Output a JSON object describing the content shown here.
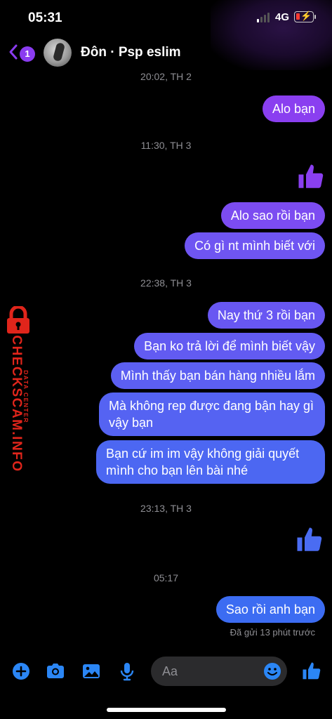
{
  "status": {
    "time": "05:31",
    "network": "4G"
  },
  "header": {
    "back_badge": "1",
    "contact_name": "Đôn · Psp eslim"
  },
  "messages": [
    {
      "type": "timestamp",
      "text": "20:02, TH 2"
    },
    {
      "type": "out",
      "text": "Alo bạn"
    },
    {
      "type": "timestamp",
      "text": "11:30, TH 3"
    },
    {
      "type": "like"
    },
    {
      "type": "out",
      "text": "Alo sao rồi bạn"
    },
    {
      "type": "out",
      "text": "Có gì nt mình biết với"
    },
    {
      "type": "timestamp",
      "text": "22:38, TH 3"
    },
    {
      "type": "out",
      "text": "Nay thứ 3 rồi bạn"
    },
    {
      "type": "out",
      "text": "Bạn ko trả lời để mình biết vậy"
    },
    {
      "type": "out",
      "text": "Mình thấy bạn bán hàng nhiều lắm"
    },
    {
      "type": "out",
      "text": "Mà không rep được đang bận hay gì vậy bạn"
    },
    {
      "type": "out",
      "text": "Bạn cứ im im vậy không giải quyết mình cho bạn lên bài nhé"
    },
    {
      "type": "timestamp",
      "text": "23:13, TH 3"
    },
    {
      "type": "like"
    },
    {
      "type": "timestamp",
      "text": "05:17"
    },
    {
      "type": "out",
      "text": "Sao rồi anh bạn"
    }
  ],
  "seen_status": "Đã gửi 13 phút trước",
  "composer": {
    "placeholder": "Aa"
  },
  "watermark": {
    "main": "CHECKSCAM.INFO",
    "sub": "DATA CENTER"
  },
  "icons": [
    "back-chevron-icon",
    "plus-icon",
    "camera-icon",
    "image-icon",
    "microphone-icon",
    "emoji-icon",
    "thumbs-up-icon",
    "lock-icon"
  ],
  "colors": {
    "background": "#000000",
    "bubble_gradient_top": "#8a3ff0",
    "bubble_gradient_bottom": "#3c6cf2",
    "accent_blue": "#2b86f5",
    "badge_purple": "#8a3cf0",
    "watermark_red": "#e0251b",
    "timestamp_gray": "#8e8e93"
  }
}
